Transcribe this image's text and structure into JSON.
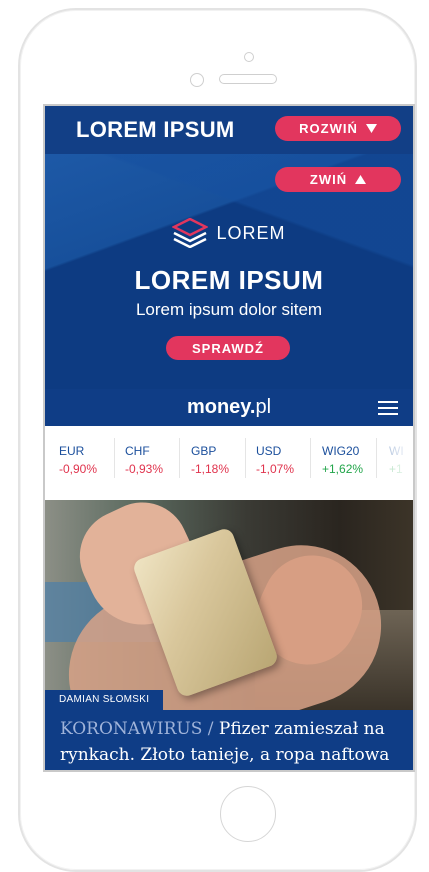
{
  "topbar": {
    "title": "LOREM IPSUM",
    "expand_label": "ROZWIŃ",
    "expand_icon": "triangle-down-icon"
  },
  "banner": {
    "collapse_label": "ZWIŃ",
    "collapse_icon": "triangle-up-icon",
    "logo_text": "LOREM",
    "title": "LOREM IPSUM",
    "subtitle": "Lorem ipsum dolor sitem",
    "cta_label": "SPRAWDŹ"
  },
  "nav": {
    "brand_main": "money",
    "brand_dot": ".",
    "brand_tld": "pl",
    "menu_icon": "hamburger-menu-icon"
  },
  "ticker": [
    {
      "name": "EUR",
      "value": "-0,90%",
      "trend": "down"
    },
    {
      "name": "CHF",
      "value": "-0,93%",
      "trend": "down"
    },
    {
      "name": "GBP",
      "value": "-1,18%",
      "trend": "down"
    },
    {
      "name": "USD",
      "value": "-1,07%",
      "trend": "down"
    },
    {
      "name": "WIG20",
      "value": "+1,62%",
      "trend": "up"
    },
    {
      "name": "WI",
      "value": "+1",
      "trend": "up"
    }
  ],
  "article": {
    "author": "DAMIAN SŁOMSKI",
    "category": "KORONAWIRUS /",
    "headline": "Pfizer zamieszał na rynkach. Złoto tanieje, a ropa naftowa"
  },
  "colors": {
    "brand_blue": "#123f86",
    "accent_pink": "#e2365e",
    "negative": "#e0334d",
    "positive": "#22a54a"
  }
}
